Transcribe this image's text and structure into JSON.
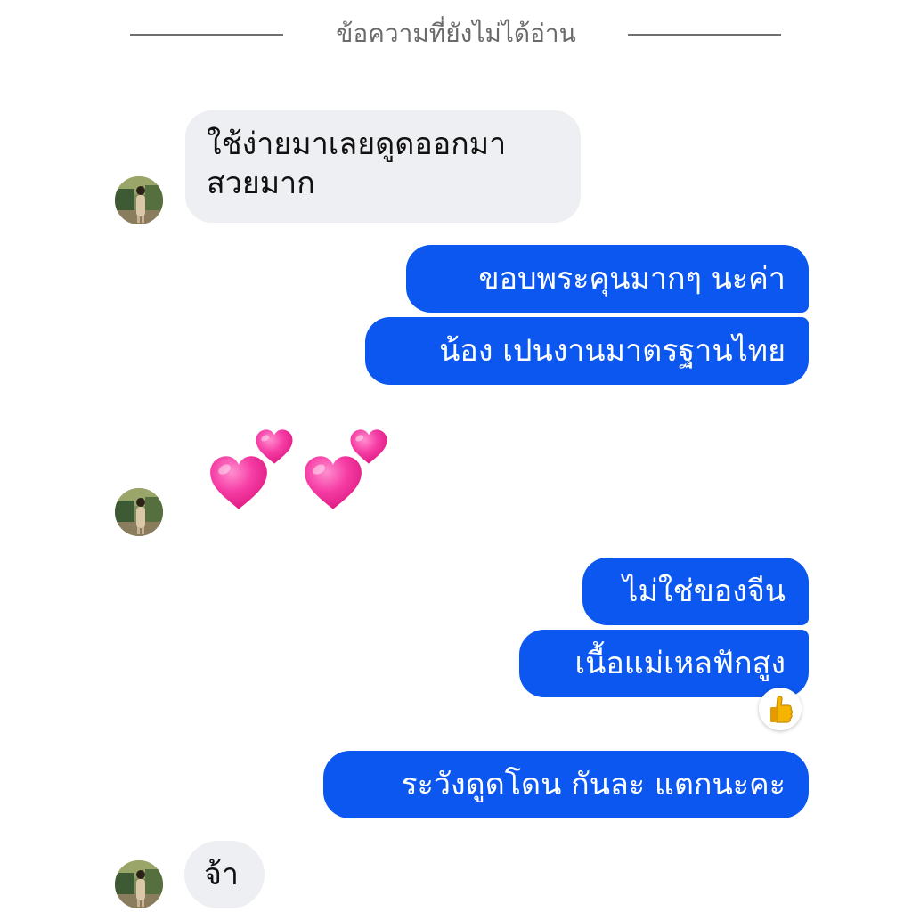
{
  "divider": {
    "label": "ข้อความที่ยังไม่ได้อ่าน"
  },
  "messages": [
    {
      "direction": "incoming",
      "lines": [
        "ใช้ง่ายมาเลยดูดออกมา",
        "สวยมาก"
      ]
    },
    {
      "direction": "outgoing",
      "text": "ขอบพระคุนมากๆ  นะค่า"
    },
    {
      "direction": "outgoing",
      "text": "น้อง เปนงานมาตรฐานไทย"
    },
    {
      "direction": "incoming",
      "sticker": "two-pink-hearts-emoji"
    },
    {
      "direction": "outgoing",
      "text": "ไม่ใช่ของจีน"
    },
    {
      "direction": "outgoing",
      "text": "เนื้อแม่เหลฟักสูง",
      "reaction": "thumbs-up-icon"
    },
    {
      "direction": "outgoing",
      "text": "ระวังดูดโดน  กันละ แตกนะคะ"
    },
    {
      "direction": "incoming",
      "text": "จ้า"
    }
  ],
  "colors": {
    "outgoing_bubble": "#0b57ef",
    "incoming_bubble": "#eeeff2",
    "outgoing_text": "#ffffff",
    "incoming_text": "#111111",
    "heart": "#f0288f",
    "divider": "#6f6f6f"
  }
}
